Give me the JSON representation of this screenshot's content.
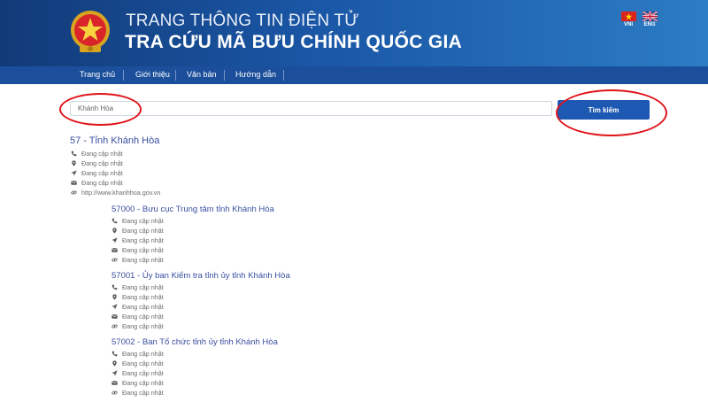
{
  "header": {
    "title_top": "TRANG THÔNG TIN ĐIỆN TỬ",
    "title_main": "TRA CỨU MÃ BƯU CHÍNH QUỐC GIA",
    "lang_vn": "VNI",
    "lang_en": "ENG",
    "colors": {
      "header_start": "#123a78",
      "header_end": "#2c7cc4",
      "nav": "#1b4f9c"
    }
  },
  "nav": {
    "items": [
      "Trang chủ",
      "Giới thiệu",
      "Văn bản",
      "Hướng dẫn"
    ]
  },
  "search": {
    "value": "Khánh Hòa",
    "button_label": "Tìm kiếm"
  },
  "annotation_color": "#e0141b",
  "result": {
    "title": "57 - Tỉnh Khánh Hòa",
    "rows": [
      {
        "icon": "phone-icon",
        "text": "Đang cập nhật"
      },
      {
        "icon": "map-pin-icon",
        "text": "Đang cập nhật"
      },
      {
        "icon": "location-arrow-icon",
        "text": "Đang cập nhật"
      },
      {
        "icon": "envelope-icon",
        "text": "Đang cập nhật"
      },
      {
        "icon": "link-icon",
        "text": "http://www.khanhhoa.gov.vn"
      }
    ],
    "children": [
      {
        "title": "57000 - Bưu cục Trung tâm tỉnh Khánh Hòa",
        "rows": [
          {
            "icon": "phone-icon",
            "text": "Đang cập nhật"
          },
          {
            "icon": "map-pin-icon",
            "text": "Đang cập nhật"
          },
          {
            "icon": "location-arrow-icon",
            "text": "Đang cập nhật"
          },
          {
            "icon": "envelope-icon",
            "text": "Đang cập nhật"
          },
          {
            "icon": "link-icon",
            "text": "Đang cập nhật"
          }
        ]
      },
      {
        "title": "57001 - Ủy ban Kiểm tra tỉnh ủy tỉnh Khánh Hòa",
        "rows": [
          {
            "icon": "phone-icon",
            "text": "Đang cập nhật"
          },
          {
            "icon": "map-pin-icon",
            "text": "Đang cập nhật"
          },
          {
            "icon": "location-arrow-icon",
            "text": "Đang cập nhật"
          },
          {
            "icon": "envelope-icon",
            "text": "Đang cập nhật"
          },
          {
            "icon": "link-icon",
            "text": "Đang cập nhật"
          }
        ]
      },
      {
        "title": "57002 - Ban Tổ chức tỉnh ủy tỉnh Khánh Hòa",
        "rows": [
          {
            "icon": "phone-icon",
            "text": "Đang cập nhật"
          },
          {
            "icon": "map-pin-icon",
            "text": "Đang cập nhật"
          },
          {
            "icon": "location-arrow-icon",
            "text": "Đang cập nhật"
          },
          {
            "icon": "envelope-icon",
            "text": "Đang cập nhật"
          },
          {
            "icon": "link-icon",
            "text": "Đang cập nhật"
          }
        ]
      }
    ]
  }
}
